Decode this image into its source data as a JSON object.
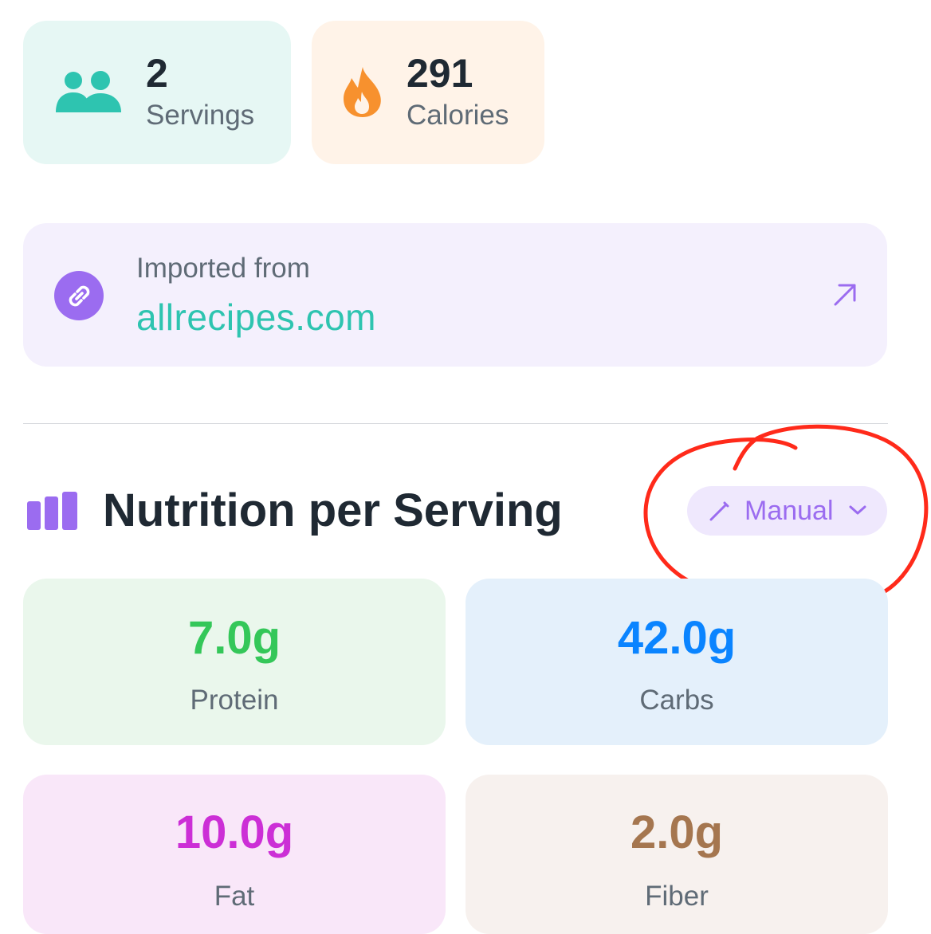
{
  "stats": {
    "servings": {
      "value": "2",
      "label": "Servings",
      "icon": "people-icon",
      "color": "#2ec4b0"
    },
    "calories": {
      "value": "291",
      "label": "Calories",
      "icon": "flame-icon",
      "color": "#f7912e"
    }
  },
  "source": {
    "caption": "Imported from",
    "site": "allrecipes.com",
    "link_icon": "link-icon",
    "open_icon": "arrow-up-right-icon"
  },
  "nutrition": {
    "title": "Nutrition per Serving",
    "icon": "bar-chart-icon",
    "mode": {
      "label": "Manual",
      "icon": "pencil-icon",
      "chevron": "chevron-down-icon"
    },
    "items": [
      {
        "value": "7.0g",
        "label": "Protein",
        "color": "#34c759"
      },
      {
        "value": "42.0g",
        "label": "Carbs",
        "color": "#0a84ff"
      },
      {
        "value": "10.0g",
        "label": "Fat",
        "color": "#cc2fd6"
      },
      {
        "value": "2.0g",
        "label": "Fiber",
        "color": "#a5764f"
      }
    ]
  },
  "colors": {
    "accent_teal": "#2ec4b0",
    "accent_purple": "#9b6cf0",
    "annotation_red": "#ff2a1a"
  }
}
